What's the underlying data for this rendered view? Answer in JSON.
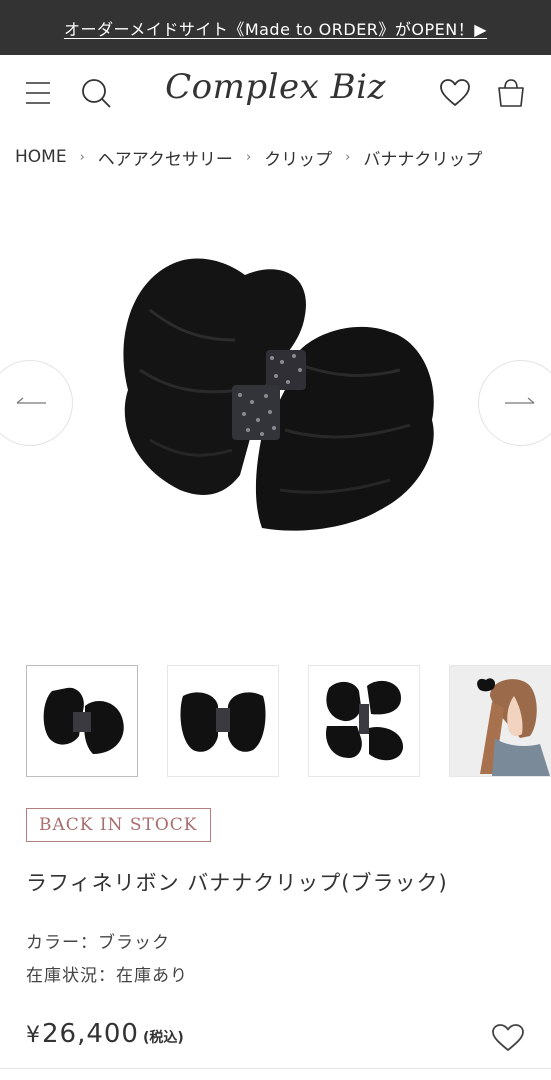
{
  "announcement": {
    "text": "オーダーメイドサイト《Made to ORDER》がOPEN！▶"
  },
  "header": {
    "logo_text": "Complex Biz",
    "icons": [
      "menu-icon",
      "search-icon",
      "heart-icon",
      "shopping-bag-icon"
    ]
  },
  "breadcrumb": {
    "items": [
      {
        "label": "HOME"
      },
      {
        "label": "ヘアアクセサリー"
      },
      {
        "label": "クリップ"
      },
      {
        "label": "バナナクリップ"
      }
    ],
    "separator": "›"
  },
  "gallery": {
    "prev_icon": "arrow-left-icon",
    "next_icon": "arrow-right-icon",
    "thumbnails": [
      {
        "name": "thumb-front",
        "selected": true
      },
      {
        "name": "thumb-top",
        "selected": false
      },
      {
        "name": "thumb-side",
        "selected": false
      },
      {
        "name": "thumb-model",
        "selected": false
      }
    ]
  },
  "product": {
    "badge": "BACK IN STOCK",
    "title": "ラフィネリボン バナナクリップ(ブラック)",
    "color_line": "カラー：ブラック",
    "stock_line": "在庫状況：在庫あり",
    "price_symbol": "¥",
    "price": "26,400",
    "tax_note": "(税込)"
  },
  "colors": {
    "announce_bg": "#333333",
    "badge_border": "#b57f7f",
    "text": "#333333"
  }
}
